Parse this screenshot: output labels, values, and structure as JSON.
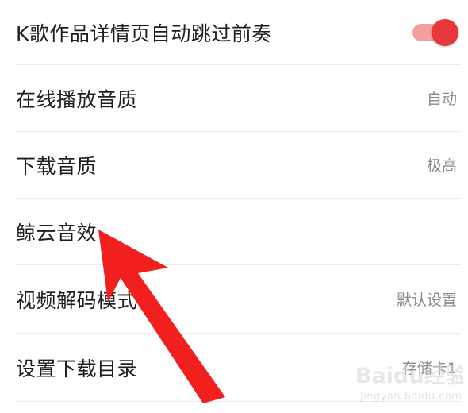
{
  "settings": [
    {
      "label": "K歌作品详情页自动跳过前奏",
      "control": "toggle",
      "toggle_on": true
    },
    {
      "label": "在线播放音质",
      "value": "自动"
    },
    {
      "label": "下载音质",
      "value": "极高"
    },
    {
      "label": "鲸云音效",
      "value": ""
    },
    {
      "label": "视频解码模式",
      "value": "默认设置"
    },
    {
      "label": "设置下载目录",
      "value": "存储卡1"
    }
  ],
  "colors": {
    "accent": "#e8373a",
    "toggle_track": "#f4a0a0",
    "arrow": "#f21f1f",
    "divider": "#ececec",
    "label_text": "#1e1e1e",
    "value_text": "#8a8a8a"
  },
  "annotation": {
    "icon": "red-arrow-icon",
    "target": "鲸云音效"
  },
  "watermark": {
    "brand": "Baidu经验",
    "url": "jingyan.baidu.com"
  }
}
